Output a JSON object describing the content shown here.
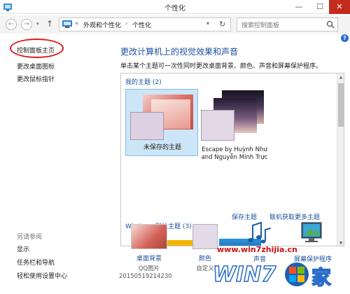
{
  "window": {
    "title": "个性化",
    "buttons": {
      "minimize": "—",
      "maximize": "☐",
      "close": "✕"
    }
  },
  "nav": {
    "back": "←",
    "forward": "→",
    "up": "↑",
    "address": {
      "chevron": "«",
      "crumbs": [
        "外观和个性化",
        "个性化"
      ],
      "separator": "›"
    },
    "search_placeholder": "搜索控制面板",
    "help": "?"
  },
  "sidebar": {
    "links": [
      "控制面板主页",
      "更改桌面图标",
      "更改鼠标指针"
    ],
    "see_also_title": "另请参阅",
    "see_also": [
      "显示",
      "任务栏和导航",
      "轻松使用设置中心"
    ]
  },
  "main": {
    "title": "更改计算机上的视觉效果和声音",
    "description": "单击某个主题可一次性同时更改桌面背景、颜色、声音和屏幕保护程序。",
    "my_themes_label": "我的主题 (2)",
    "themes": [
      {
        "name": "未保存的主题",
        "selected": true
      },
      {
        "name": "Escape by Huỳnh Như and Nguyễn Minh Trực",
        "selected": false
      }
    ],
    "links": {
      "save": "保存主题",
      "online": "联机获取更多主题"
    },
    "windows_themes_label": "Windows 默认主题 (3)"
  },
  "bottom": {
    "background": {
      "label": "桌面背景",
      "sub": "QQ图片",
      "sub2": "20150519214230"
    },
    "color": {
      "label": "颜色",
      "sub": "自定义"
    },
    "sound": {
      "label": "声音"
    },
    "screensaver": {
      "label": "屏幕保护程序"
    }
  },
  "watermark": {
    "url": "www.win7zhijia.cn"
  },
  "colors": {
    "accent": "#1b4fa0",
    "selection": "#cce6f7",
    "annotation": "#e01818"
  }
}
